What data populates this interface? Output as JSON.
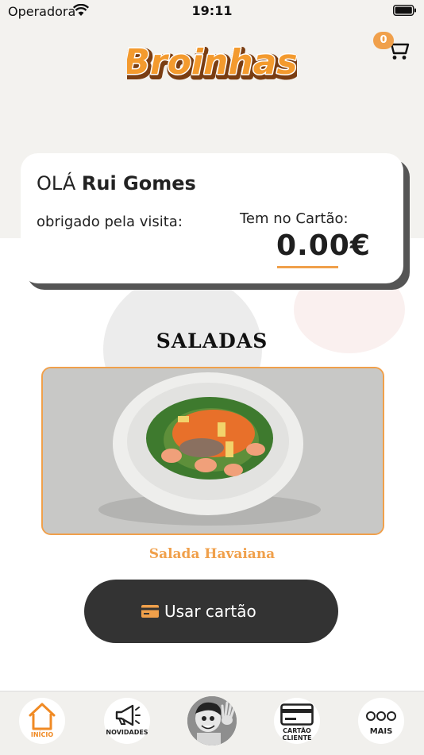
{
  "status_bar": {
    "carrier": "Operadora",
    "time": "19:11"
  },
  "header": {
    "logo_text": "Broinhas",
    "cart_count": "0"
  },
  "card": {
    "greeting_prefix": "OLÁ",
    "user_name": "Rui Gomes",
    "thanks": "obrigado pela visita:",
    "balance_label": "Tem no Cartão:",
    "balance": "0.00€"
  },
  "section": {
    "title": "SALADAS"
  },
  "product": {
    "name": "Salada Havaiana"
  },
  "action_button": {
    "label": "Usar cartão",
    "icon": "credit-card-icon"
  },
  "tabbar": {
    "items": [
      {
        "label": "INÍCIO",
        "icon": "home-icon",
        "active": true
      },
      {
        "label": "NOVIDADES",
        "icon": "megaphone-icon"
      },
      {
        "label": "",
        "icon": "mascot-avatar"
      },
      {
        "label": "CARTÃO\nCLIENTE",
        "label_line1": "CARTÃO",
        "label_line2": "CLIENTE",
        "icon": "card-icon"
      },
      {
        "label": "MAIS",
        "icon": "more-icon"
      }
    ]
  },
  "colors": {
    "accent": "#f0a04b",
    "dark": "#333333",
    "background": "#f3f2ef"
  }
}
